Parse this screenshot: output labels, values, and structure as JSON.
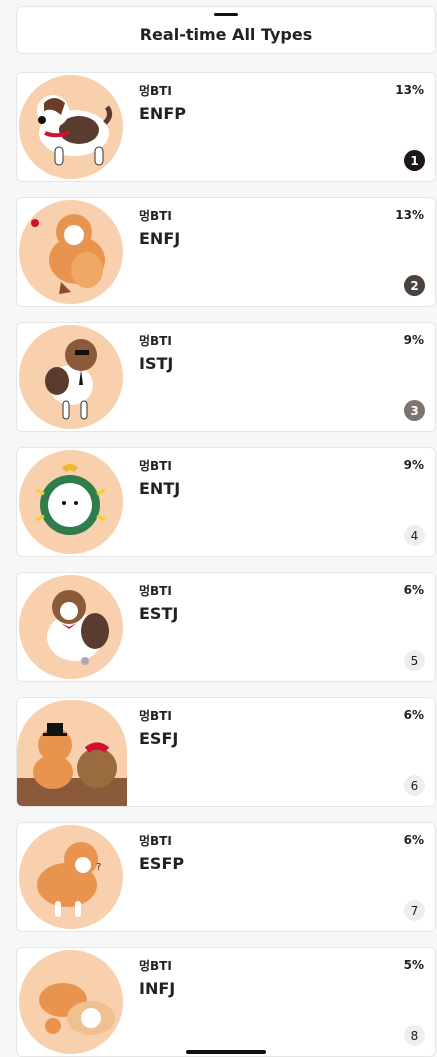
{
  "header": {
    "title": "Real-time All Types"
  },
  "cards": [
    {
      "brand": "멍BTI",
      "type": "ENFP",
      "percent": "13%",
      "rank": "1"
    },
    {
      "brand": "멍BTI",
      "type": "ENFJ",
      "percent": "13%",
      "rank": "2"
    },
    {
      "brand": "멍BTI",
      "type": "ISTJ",
      "percent": "9%",
      "rank": "3"
    },
    {
      "brand": "멍BTI",
      "type": "ENTJ",
      "percent": "9%",
      "rank": "4"
    },
    {
      "brand": "멍BTI",
      "type": "ESTJ",
      "percent": "6%",
      "rank": "5"
    },
    {
      "brand": "멍BTI",
      "type": "ESFJ",
      "percent": "6%",
      "rank": "6"
    },
    {
      "brand": "멍BTI",
      "type": "ESFP",
      "percent": "6%",
      "rank": "7"
    },
    {
      "brand": "멍BTI",
      "type": "INFJ",
      "percent": "5%",
      "rank": "8"
    }
  ],
  "colors": {
    "thumb_bg": "#f8d0ad",
    "rank_1": "#1f1714",
    "rank_2": "#4b413d",
    "rank_3": "#7d7470",
    "rank_plain": "#eeeeee"
  }
}
